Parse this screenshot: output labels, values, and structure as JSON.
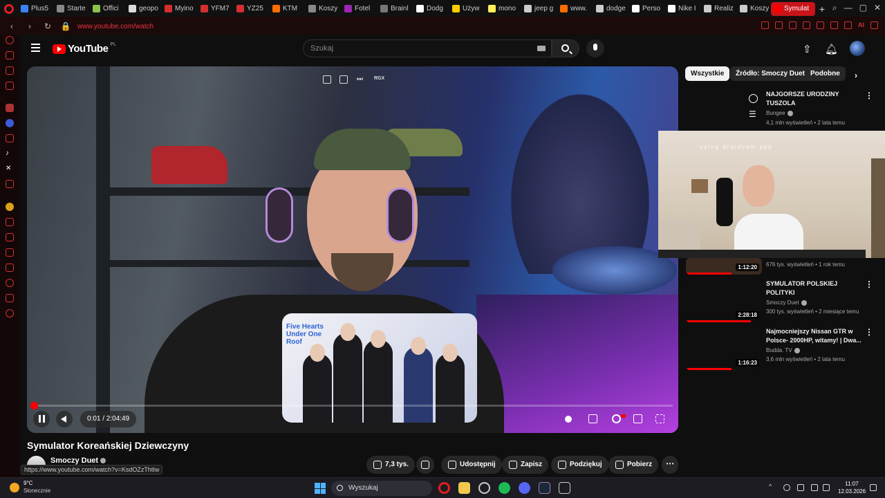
{
  "browser": {
    "tabs": [
      {
        "label": "Plus5",
        "color": "#3b82f6"
      },
      {
        "label": "Starte",
        "color": "#888888"
      },
      {
        "label": "Offici",
        "color": "#8bc34a"
      },
      {
        "label": "geopo",
        "color": "#dddddd"
      },
      {
        "label": "Myino",
        "color": "#d32f2f"
      },
      {
        "label": "YFM7",
        "color": "#d32f2f"
      },
      {
        "label": "YZ25",
        "color": "#d32f2f"
      },
      {
        "label": "KTM",
        "color": "#ff6d00"
      },
      {
        "label": "Koszy",
        "color": "#888888"
      },
      {
        "label": "Fotel",
        "color": "#9c27b0"
      },
      {
        "label": "Brainl",
        "color": "#777777"
      },
      {
        "label": "Dodg",
        "color": "#ffffff"
      },
      {
        "label": "Używ",
        "color": "#ffcc00"
      },
      {
        "label": "mono",
        "color": "#ffee58"
      },
      {
        "label": "jeep g",
        "color": "#cccccc"
      },
      {
        "label": "www.",
        "color": "#ff6d00"
      },
      {
        "label": "dodge",
        "color": "#cccccc"
      },
      {
        "label": "Perso",
        "color": "#ffffff"
      },
      {
        "label": "Nike I",
        "color": "#ffffff"
      },
      {
        "label": "Realiz",
        "color": "#cccccc"
      },
      {
        "label": "Koszy",
        "color": "#cccccc"
      }
    ],
    "active_tab": {
      "label": "Symulat",
      "color": "#ff0000"
    },
    "new_tab": "+",
    "url": "www.youtube.com/watch",
    "ai_label": "AI"
  },
  "youtube": {
    "logo": "YouTube",
    "country": "PL",
    "search_placeholder": "Szukaj",
    "video": {
      "title": "Symulator Koreańskiej Dziewczyny",
      "current_time": "0:01",
      "duration": "2:04:49",
      "time_display": "0:01 / 2:04:49",
      "progress": 0.0001,
      "poster_title": "Five Hearts Under One Roof",
      "top_badge": "RGX"
    },
    "channel": {
      "name": "Smoczy Duet"
    },
    "hover_url": "https://www.youtube.com/watch?v=KsdOZzThtIw",
    "actions": {
      "likes": "7,3 tys.",
      "share": "Udostępnij",
      "save": "Zapisz",
      "thanks": "Podziękuj",
      "download": "Pobierz"
    },
    "chips": [
      "Wszystkie",
      "Źródło: Smoczy Duet",
      "Podobne"
    ],
    "recommendations": [
      {
        "title": "NAJGORSZE URODZINY TUSZOLA",
        "channel": "Bungee",
        "meta": "4,1 mln wyświetleń • 2 lata temu",
        "duration": "",
        "progress": 0
      },
      {
        "title": "",
        "channel": "",
        "meta": "676 tys. wyświetleń • 1 rok temu",
        "duration": "1:12:20",
        "progress": 0.6
      },
      {
        "title": "SYMULATOR POLSKIEJ POLITYKI",
        "channel": "Smoczy Duet",
        "meta": "300 tys. wyświetleń • 2 miesiące temu",
        "duration": "2:28:18",
        "progress": 0.85
      },
      {
        "title": "Najmocniejszy Nissan GTR w Polsce- 2000HP, witamy! | Dwa...",
        "channel": "Budda. TV",
        "meta": "3,6 mln wyświetleń • 2 lata temu",
        "duration": "1:16:23",
        "progress": 0.6
      }
    ],
    "webcam_overlay": "using droidcam.app"
  },
  "taskbar": {
    "temperature": "9°C",
    "condition": "Słonecznie",
    "search": "Wyszukaj",
    "time": "11:07",
    "date": "12.03.2026"
  }
}
